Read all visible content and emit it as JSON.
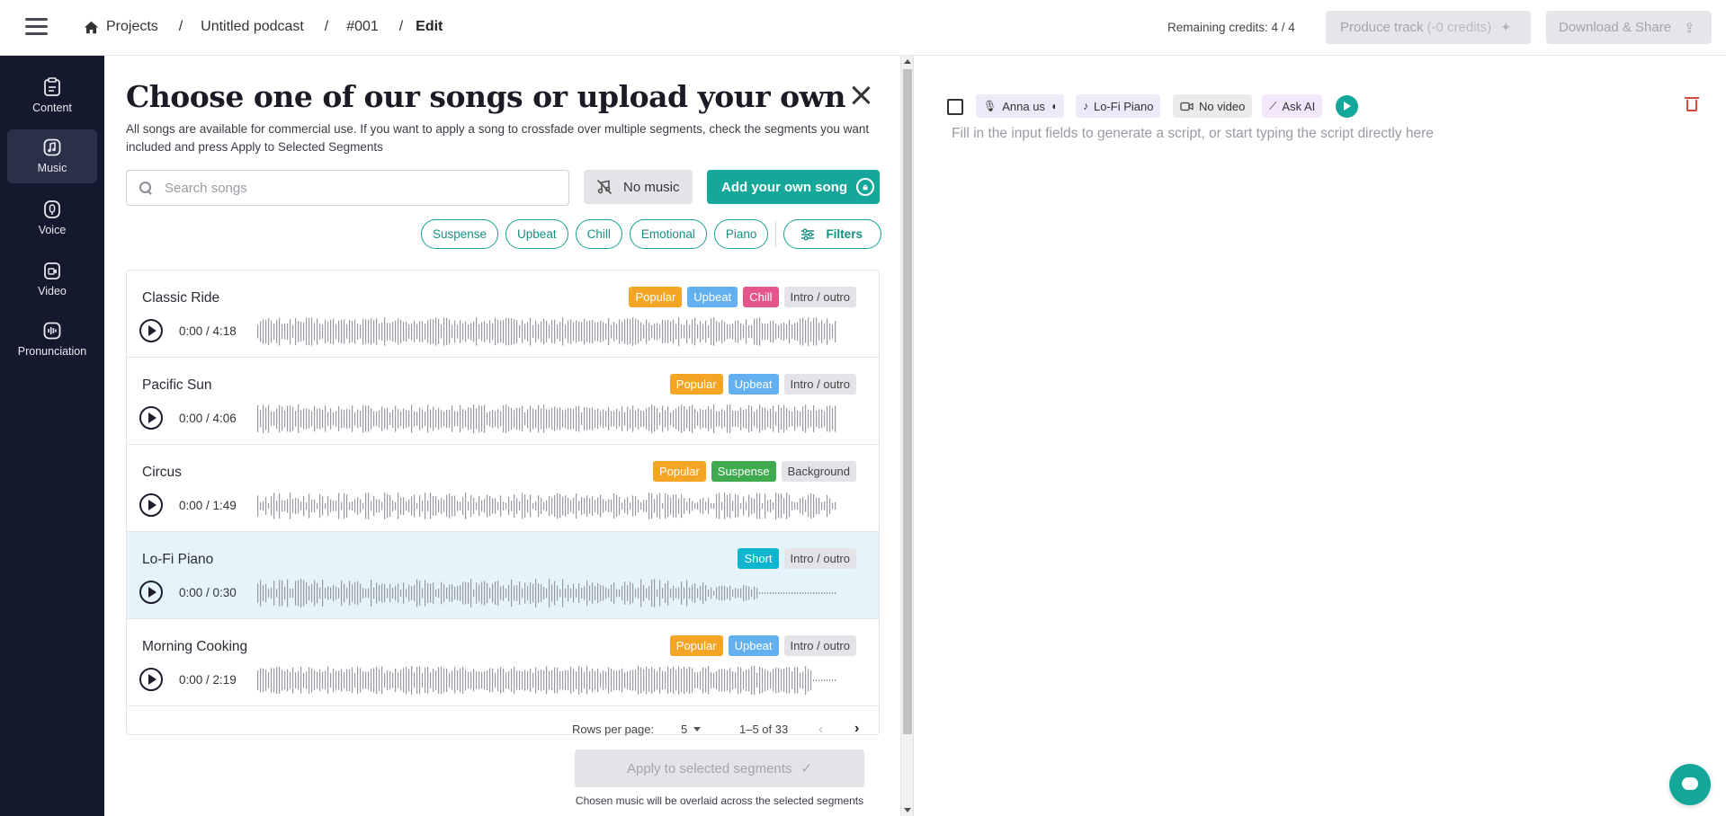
{
  "breadcrumb": {
    "projects": "Projects",
    "podcast": "Untitled podcast",
    "episode": "#001",
    "current": "Edit"
  },
  "header": {
    "credits": "Remaining credits: 4 / 4",
    "produce_label": "Produce track",
    "produce_credits": "(-0 credits)",
    "download_label": "Download & Share"
  },
  "sidebar": {
    "items": [
      {
        "label": "Content",
        "icon": "content-icon"
      },
      {
        "label": "Music",
        "icon": "music-icon",
        "active": true
      },
      {
        "label": "Voice",
        "icon": "voice-icon"
      },
      {
        "label": "Video",
        "icon": "video-icon"
      },
      {
        "label": "Pronunciation",
        "icon": "pronunciation-icon"
      }
    ]
  },
  "music_panel": {
    "title": "Choose one of our songs or upload your own",
    "description": "All songs are available for commercial use. If you want to apply a song to crossfade over multiple segments, check the segments you want included and press Apply to Selected Segments",
    "search_placeholder": "Search songs",
    "no_music_label": "No music",
    "add_song_label": "Add your own song",
    "filter_chips": [
      "Suspense",
      "Upbeat",
      "Chill",
      "Emotional",
      "Piano"
    ],
    "filters_label": "Filters",
    "songs": [
      {
        "title": "Classic Ride",
        "time": "0:00 / 4:18",
        "tags": [
          {
            "t": "Popular",
            "c": "#f5a524"
          },
          {
            "t": "Upbeat",
            "c": "#62b0ef"
          },
          {
            "t": "Chill",
            "c": "#e5548d"
          },
          {
            "t": "Intro / outro",
            "c": ""
          }
        ],
        "selected": false,
        "progress": 0
      },
      {
        "title": "Pacific Sun",
        "time": "0:00 / 4:06",
        "tags": [
          {
            "t": "Popular",
            "c": "#f5a524"
          },
          {
            "t": "Upbeat",
            "c": "#62b0ef"
          },
          {
            "t": "Intro / outro",
            "c": ""
          }
        ],
        "selected": false,
        "progress": 0
      },
      {
        "title": "Circus",
        "time": "0:00 / 1:49",
        "tags": [
          {
            "t": "Popular",
            "c": "#f5a524"
          },
          {
            "t": "Suspense",
            "c": "#3faa4e"
          },
          {
            "t": "Background",
            "c": ""
          }
        ],
        "selected": false,
        "progress": 0
      },
      {
        "title": "Lo-Fi Piano",
        "time": "0:00 / 0:30",
        "tags": [
          {
            "t": "Short",
            "c": "#0eb5cf"
          },
          {
            "t": "Intro / outro",
            "c": ""
          }
        ],
        "selected": true,
        "progress": 0
      },
      {
        "title": "Morning Cooking",
        "time": "0:00 / 2:19",
        "tags": [
          {
            "t": "Popular",
            "c": "#f5a524"
          },
          {
            "t": "Upbeat",
            "c": "#62b0ef"
          },
          {
            "t": "Intro / outro",
            "c": ""
          }
        ],
        "selected": false,
        "progress": 0
      }
    ],
    "pagination": {
      "rows_label": "Rows per page:",
      "rows_value": "5",
      "range": "1–5 of 33"
    },
    "apply_label": "Apply to selected segments",
    "apply_note": "Chosen music will be overlaid across the selected segments"
  },
  "segment": {
    "voice": "Anna us",
    "music": "Lo-Fi Piano",
    "video": "No video",
    "ai": "Ask AI",
    "script_placeholder": "Fill in the input fields to generate a script, or start typing the script directly here"
  },
  "colors": {
    "accent": "#15a89a",
    "sidebar_bg": "#14192e",
    "selected_row": "#e5f4fb",
    "waveform": "#9a9aa3"
  }
}
